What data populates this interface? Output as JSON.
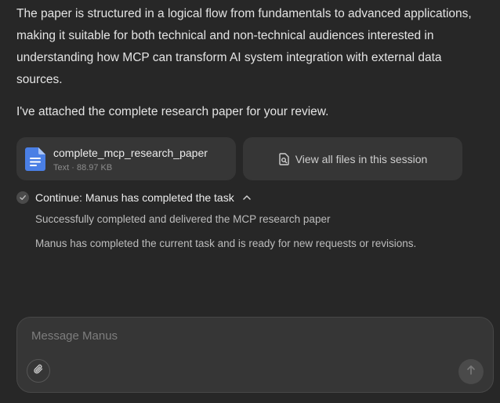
{
  "message": {
    "paragraph1": "The paper is structured in a logical flow from fundamentals to advanced applications, making it suitable for both technical and non-technical audiences interested in understanding how MCP can transform AI system integration with external data sources.",
    "paragraph2": "I've attached the complete research paper for your review."
  },
  "attachments": {
    "file": {
      "name": "complete_mcp_research_paper",
      "type": "Text",
      "size": "88.97 KB",
      "icon": "document-icon",
      "icon_color": "#4a7fe5"
    },
    "view_all_label": "View all files in this session",
    "view_all_icon": "file-search-icon"
  },
  "task": {
    "title": "Continue: Manus has completed the task",
    "status_icon": "check-circle-icon",
    "expanded": true,
    "lines": [
      "Successfully completed and delivered the MCP research paper",
      "Manus has completed the current task and is ready for new requests or revisions."
    ]
  },
  "composer": {
    "placeholder": "Message Manus",
    "value": "",
    "attach_icon": "paperclip-icon",
    "send_icon": "arrow-up-icon"
  },
  "colors": {
    "background": "#272727",
    "card": "#363636"
  }
}
